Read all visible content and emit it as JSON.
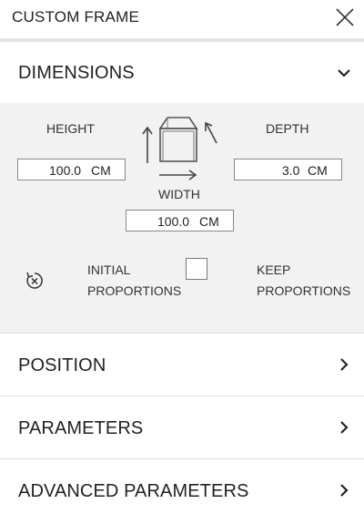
{
  "header": {
    "title": "CUSTOM FRAME",
    "close_icon": "close-icon"
  },
  "dimensions": {
    "label": "DIMENSIONS",
    "expanded": true,
    "icon": "chevron-down-icon",
    "height_label": "HEIGHT",
    "depth_label": "DEPTH",
    "width_label": "WIDTH",
    "height_value": "100.0",
    "depth_value": "3.0",
    "width_value": "100.0",
    "unit": "CM",
    "frame_icon": "frame-3d-icon",
    "reset_icon": "reset-proportions-icon",
    "initial_line1": "INITIAL",
    "initial_line2": "PROPORTIONS",
    "keep_line1": "KEEP",
    "keep_line2": "PROPORTIONS",
    "keep_proportions_checked": false
  },
  "sections": {
    "position": "POSITION",
    "parameters": "PARAMETERS",
    "advanced": "ADVANCED PARAMETERS",
    "icon": "chevron-right-icon"
  }
}
